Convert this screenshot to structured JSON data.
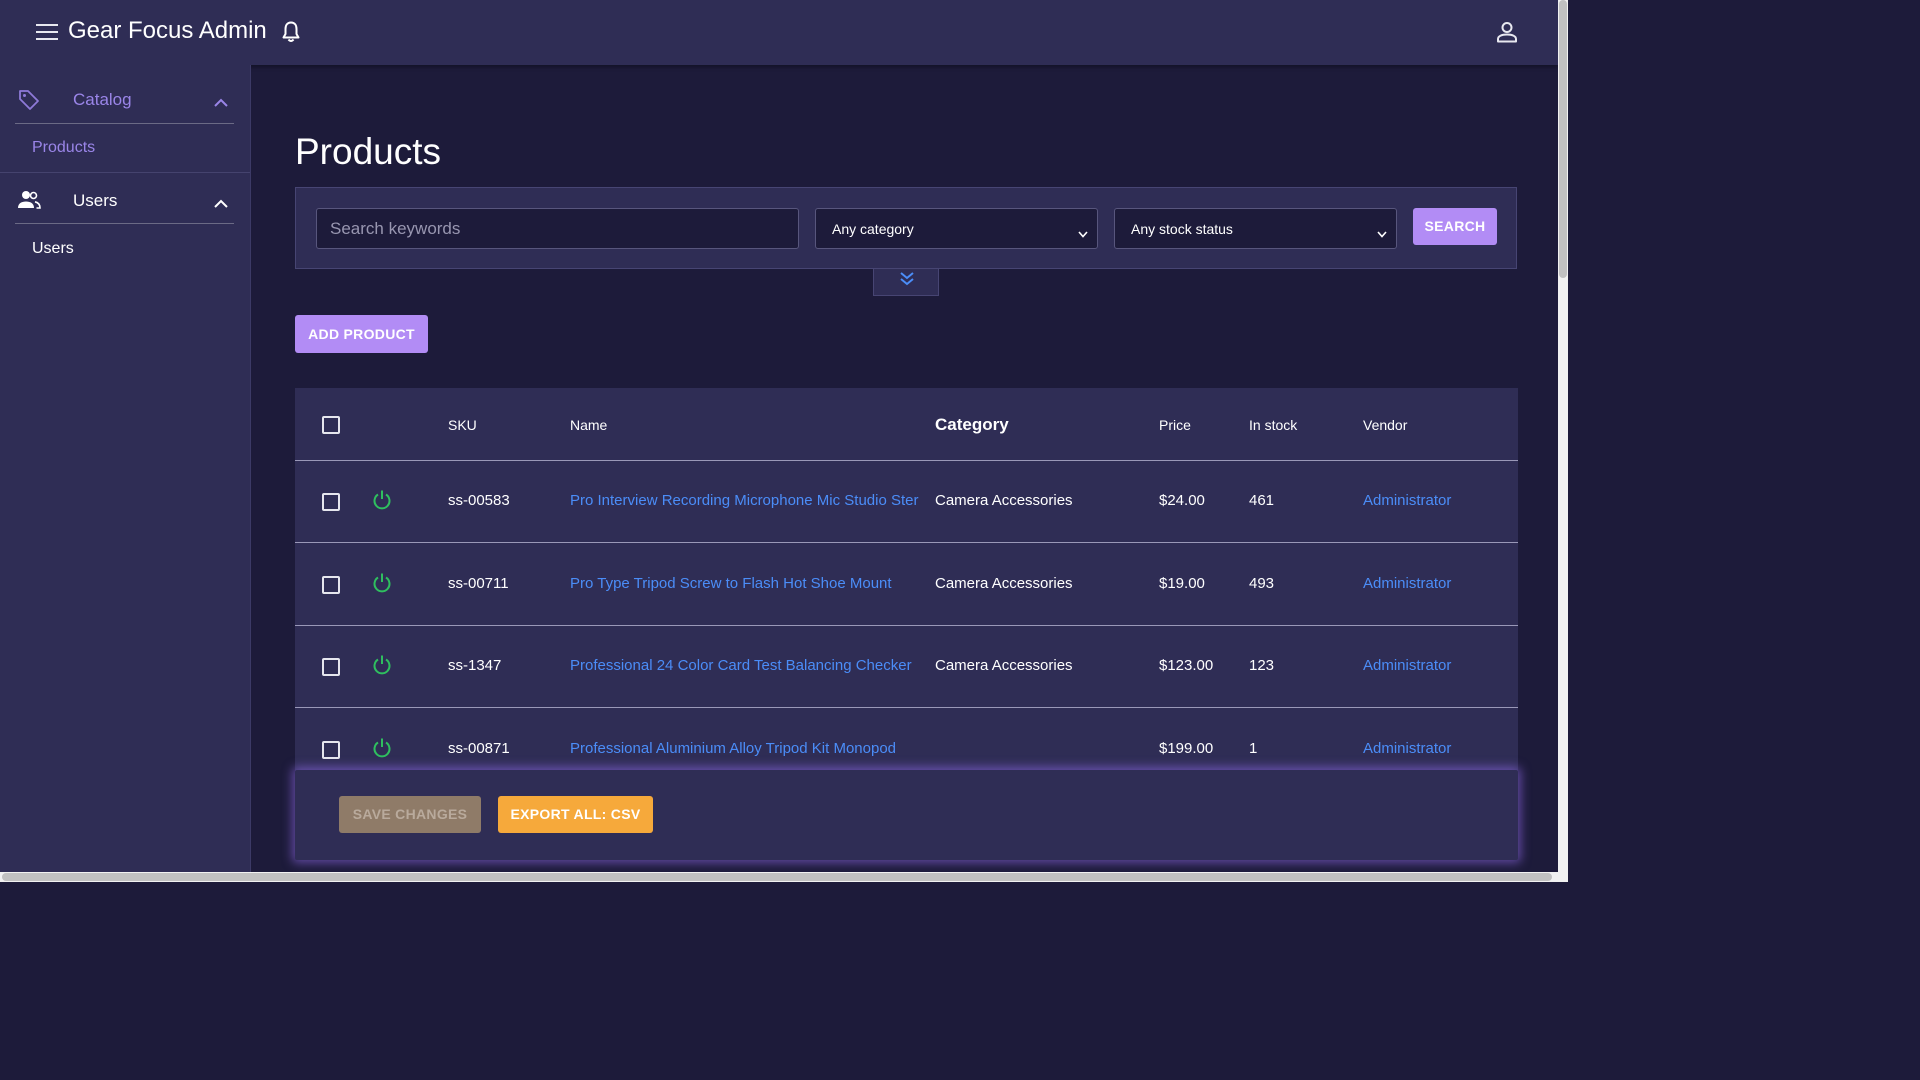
{
  "header": {
    "app_title": "Gear Focus Admin",
    "menu_icon": "hamburger-menu-icon",
    "notification_icon": "bell-icon",
    "account_icon": "user-account-icon"
  },
  "sidebar": {
    "sections": [
      {
        "label": "Catalog",
        "icon": "tag-icon",
        "expanded": true,
        "items": [
          {
            "label": "Products",
            "active": true
          }
        ]
      },
      {
        "label": "Users",
        "icon": "users-group-icon",
        "expanded": true,
        "items": [
          {
            "label": "Users",
            "active": false
          }
        ]
      }
    ]
  },
  "page": {
    "title": "Products"
  },
  "filters": {
    "search_placeholder": "Search keywords",
    "category_selected": "Any category",
    "stock_selected": "Any stock status",
    "search_label": "SEARCH"
  },
  "actions": {
    "add_product_label": "ADD PRODUCT"
  },
  "table": {
    "columns": [
      "SKU",
      "Name",
      "Category",
      "Price",
      "In stock",
      "Vendor"
    ],
    "rows": [
      {
        "sku": "ss-00583",
        "name": "Pro Interview Recording Microphone Mic Studio Stereo",
        "category": "Camera Accessories",
        "price": "$24.00",
        "stock": "461",
        "vendor": "Administrator"
      },
      {
        "sku": "ss-00711",
        "name": "Pro Type Tripod Screw to Flash Hot Shoe Mount",
        "category": "Camera Accessories",
        "price": "$19.00",
        "stock": "493",
        "vendor": "Administrator"
      },
      {
        "sku": "ss-1347",
        "name": "Professional 24 Color Card Test Balancing Checker",
        "category": "Camera Accessories",
        "price": "$123.00",
        "stock": "123",
        "vendor": "Administrator"
      },
      {
        "sku": "ss-00871",
        "name": "Professional Aluminium Alloy Tripod Kit Monopod",
        "category": "",
        "price": "$199.00",
        "stock": "1",
        "vendor": "Administrator"
      }
    ]
  },
  "footer": {
    "save_label": "SAVE CHANGES",
    "export_label": "EXPORT ALL: CSV"
  },
  "colors": {
    "background": "#1d1b3a",
    "panel": "#2f2d55",
    "accent": "#b28cf5",
    "link": "#4b8df8",
    "enabled_green": "#2fbf5f",
    "export": "#f6a93b"
  }
}
